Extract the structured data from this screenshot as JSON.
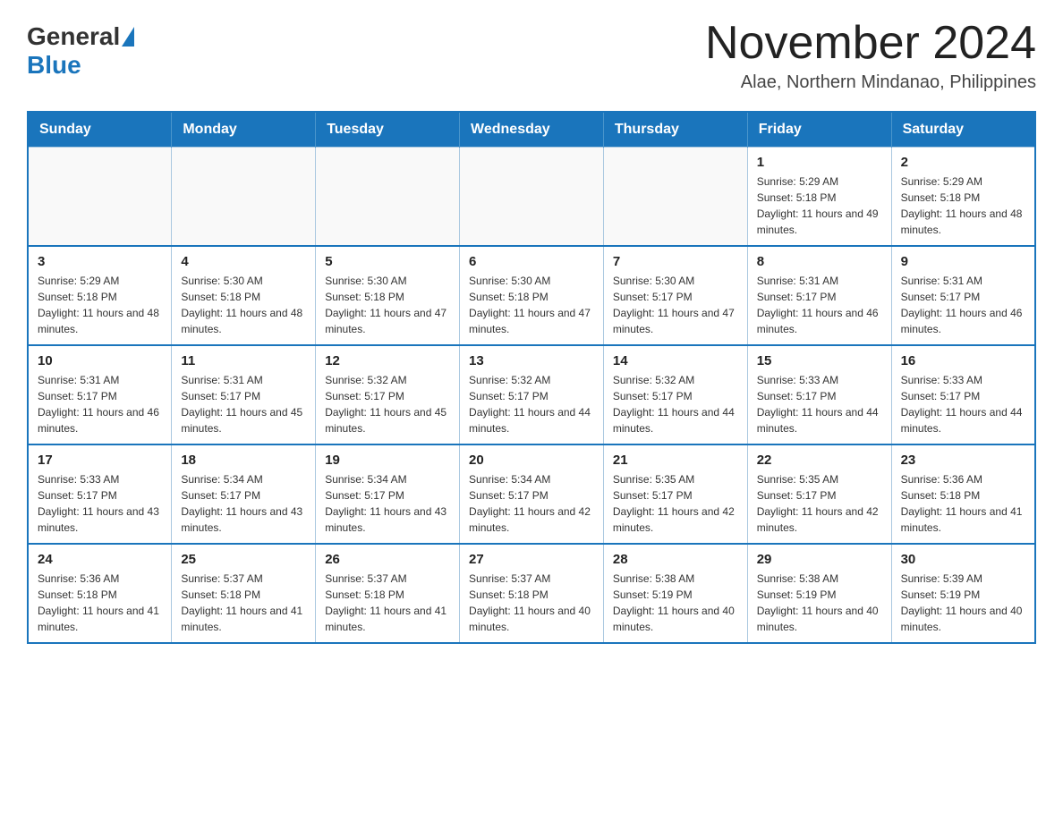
{
  "logo": {
    "general": "General",
    "blue": "Blue"
  },
  "header": {
    "month_title": "November 2024",
    "location": "Alae, Northern Mindanao, Philippines"
  },
  "weekdays": [
    "Sunday",
    "Monday",
    "Tuesday",
    "Wednesday",
    "Thursday",
    "Friday",
    "Saturday"
  ],
  "weeks": [
    [
      {
        "day": "",
        "info": ""
      },
      {
        "day": "",
        "info": ""
      },
      {
        "day": "",
        "info": ""
      },
      {
        "day": "",
        "info": ""
      },
      {
        "day": "",
        "info": ""
      },
      {
        "day": "1",
        "info": "Sunrise: 5:29 AM\nSunset: 5:18 PM\nDaylight: 11 hours and 49 minutes."
      },
      {
        "day": "2",
        "info": "Sunrise: 5:29 AM\nSunset: 5:18 PM\nDaylight: 11 hours and 48 minutes."
      }
    ],
    [
      {
        "day": "3",
        "info": "Sunrise: 5:29 AM\nSunset: 5:18 PM\nDaylight: 11 hours and 48 minutes."
      },
      {
        "day": "4",
        "info": "Sunrise: 5:30 AM\nSunset: 5:18 PM\nDaylight: 11 hours and 48 minutes."
      },
      {
        "day": "5",
        "info": "Sunrise: 5:30 AM\nSunset: 5:18 PM\nDaylight: 11 hours and 47 minutes."
      },
      {
        "day": "6",
        "info": "Sunrise: 5:30 AM\nSunset: 5:18 PM\nDaylight: 11 hours and 47 minutes."
      },
      {
        "day": "7",
        "info": "Sunrise: 5:30 AM\nSunset: 5:17 PM\nDaylight: 11 hours and 47 minutes."
      },
      {
        "day": "8",
        "info": "Sunrise: 5:31 AM\nSunset: 5:17 PM\nDaylight: 11 hours and 46 minutes."
      },
      {
        "day": "9",
        "info": "Sunrise: 5:31 AM\nSunset: 5:17 PM\nDaylight: 11 hours and 46 minutes."
      }
    ],
    [
      {
        "day": "10",
        "info": "Sunrise: 5:31 AM\nSunset: 5:17 PM\nDaylight: 11 hours and 46 minutes."
      },
      {
        "day": "11",
        "info": "Sunrise: 5:31 AM\nSunset: 5:17 PM\nDaylight: 11 hours and 45 minutes."
      },
      {
        "day": "12",
        "info": "Sunrise: 5:32 AM\nSunset: 5:17 PM\nDaylight: 11 hours and 45 minutes."
      },
      {
        "day": "13",
        "info": "Sunrise: 5:32 AM\nSunset: 5:17 PM\nDaylight: 11 hours and 44 minutes."
      },
      {
        "day": "14",
        "info": "Sunrise: 5:32 AM\nSunset: 5:17 PM\nDaylight: 11 hours and 44 minutes."
      },
      {
        "day": "15",
        "info": "Sunrise: 5:33 AM\nSunset: 5:17 PM\nDaylight: 11 hours and 44 minutes."
      },
      {
        "day": "16",
        "info": "Sunrise: 5:33 AM\nSunset: 5:17 PM\nDaylight: 11 hours and 44 minutes."
      }
    ],
    [
      {
        "day": "17",
        "info": "Sunrise: 5:33 AM\nSunset: 5:17 PM\nDaylight: 11 hours and 43 minutes."
      },
      {
        "day": "18",
        "info": "Sunrise: 5:34 AM\nSunset: 5:17 PM\nDaylight: 11 hours and 43 minutes."
      },
      {
        "day": "19",
        "info": "Sunrise: 5:34 AM\nSunset: 5:17 PM\nDaylight: 11 hours and 43 minutes."
      },
      {
        "day": "20",
        "info": "Sunrise: 5:34 AM\nSunset: 5:17 PM\nDaylight: 11 hours and 42 minutes."
      },
      {
        "day": "21",
        "info": "Sunrise: 5:35 AM\nSunset: 5:17 PM\nDaylight: 11 hours and 42 minutes."
      },
      {
        "day": "22",
        "info": "Sunrise: 5:35 AM\nSunset: 5:17 PM\nDaylight: 11 hours and 42 minutes."
      },
      {
        "day": "23",
        "info": "Sunrise: 5:36 AM\nSunset: 5:18 PM\nDaylight: 11 hours and 41 minutes."
      }
    ],
    [
      {
        "day": "24",
        "info": "Sunrise: 5:36 AM\nSunset: 5:18 PM\nDaylight: 11 hours and 41 minutes."
      },
      {
        "day": "25",
        "info": "Sunrise: 5:37 AM\nSunset: 5:18 PM\nDaylight: 11 hours and 41 minutes."
      },
      {
        "day": "26",
        "info": "Sunrise: 5:37 AM\nSunset: 5:18 PM\nDaylight: 11 hours and 41 minutes."
      },
      {
        "day": "27",
        "info": "Sunrise: 5:37 AM\nSunset: 5:18 PM\nDaylight: 11 hours and 40 minutes."
      },
      {
        "day": "28",
        "info": "Sunrise: 5:38 AM\nSunset: 5:19 PM\nDaylight: 11 hours and 40 minutes."
      },
      {
        "day": "29",
        "info": "Sunrise: 5:38 AM\nSunset: 5:19 PM\nDaylight: 11 hours and 40 minutes."
      },
      {
        "day": "30",
        "info": "Sunrise: 5:39 AM\nSunset: 5:19 PM\nDaylight: 11 hours and 40 minutes."
      }
    ]
  ]
}
